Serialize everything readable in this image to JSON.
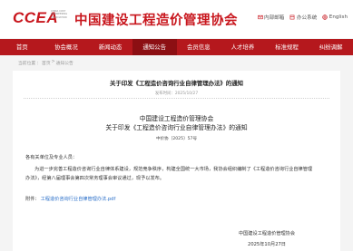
{
  "header": {
    "logo_text": "CCEA",
    "logo_sub": "CHINA COST ENGINEERING ASSOCIATION",
    "org_name": "中国建设工程造价管理协会",
    "links": [
      {
        "label": "内部邮箱",
        "icon": "mail-icon"
      },
      {
        "label": "办公系统",
        "icon": "office-icon"
      },
      {
        "label": "English",
        "icon": "globe-icon"
      }
    ]
  },
  "nav": {
    "items": [
      "首页",
      "协会概况",
      "新闻动态",
      "通知公告",
      "会员信息",
      "人才培养",
      "标准规程",
      "纠纷调解"
    ],
    "active_index": 3
  },
  "breadcrumb": {
    "current": "当前位置",
    "sep": "：",
    "home": "首页",
    "arrow": " > ",
    "section": "通知公告"
  },
  "article": {
    "title": "关于印发《工程造价咨询行业自律管理办法》的通知",
    "published": "发布时间：2025/10/27",
    "org_header": "中国建设工程造价管理协会",
    "doc_title": "关于印发《工程造价咨询行业自律管理办法》的通知",
    "doc_number": "中价协〔2025〕57号",
    "greeting": "各有关单位及专业人员：",
    "body": "为进一步完善工程造价咨询行业自律体系建设，规范竞争秩序，构建全国统一大市场，我协会组织编制了《工程造价咨询行业自律管理办法》，经第八届理事会第四次常务理事会审议通过，现予以发布。",
    "attachment_label": "附件：",
    "attachment_link": "工程造价咨询行业自律管理办法.pdf",
    "sign_org": "中国建设工程造价管理协会",
    "sign_date": "2025年10月27日"
  },
  "colors": {
    "brand_red": "#c8161d",
    "nav_red": "#b5181d",
    "nav_active": "#8c0f13",
    "link_blue": "#2a6fc9"
  }
}
